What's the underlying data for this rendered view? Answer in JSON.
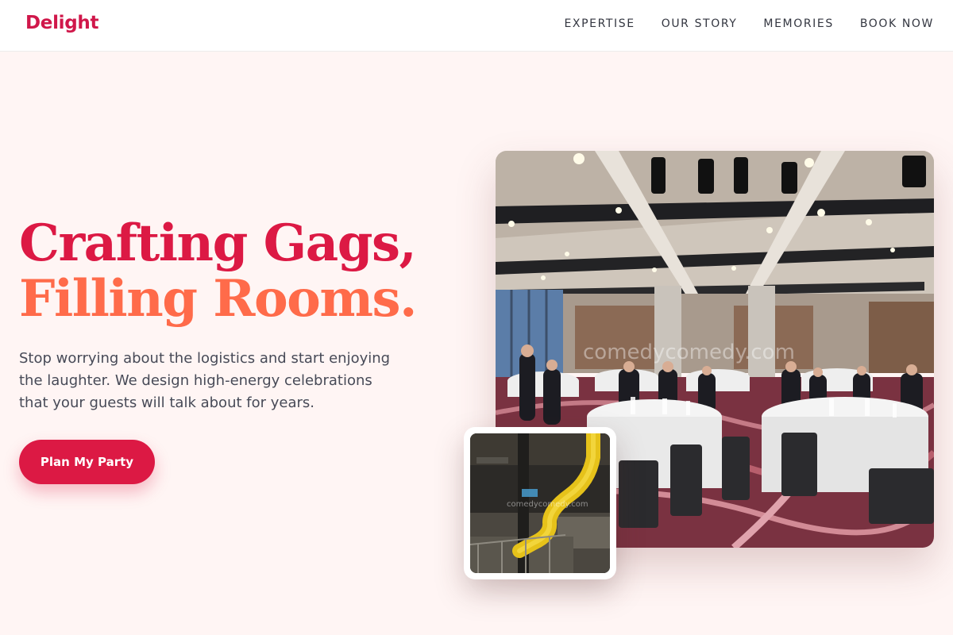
{
  "brand": {
    "name": "Delight",
    "accent": "#dc1944",
    "accent_secondary": "#ff6b4a",
    "background": "#fff5f4"
  },
  "nav": {
    "links": [
      {
        "label": "EXPERTISE"
      },
      {
        "label": "OUR STORY"
      },
      {
        "label": "MEMORIES"
      },
      {
        "label": "BOOK NOW"
      }
    ]
  },
  "hero": {
    "headline_line1": "Crafting Gags,",
    "headline_line2": "Filling Rooms.",
    "subtext": "Stop worrying about the logistics and start enjoying the laughter. We design high-energy celebrations that your guests will talk about for years.",
    "cta_label": "Plan My Party"
  },
  "images": {
    "main": {
      "icon": "banquet-hall-photo",
      "watermark": "comedycomedy.com"
    },
    "inset": {
      "icon": "yellow-slide-photo",
      "watermark": "comedycomedy.com"
    }
  }
}
